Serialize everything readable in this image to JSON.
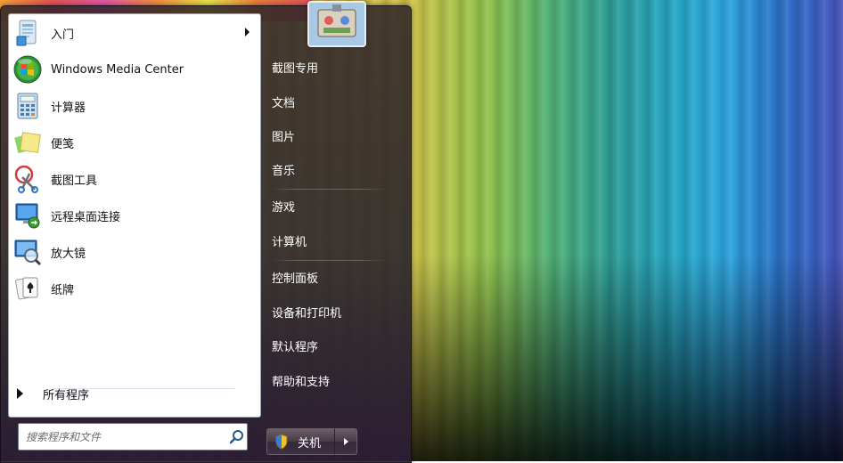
{
  "start_menu": {
    "programs": [
      {
        "label": "入门",
        "icon": "getting-started-icon",
        "has_submenu": true
      },
      {
        "label": "Windows Media Center",
        "icon": "windows-media-center-icon"
      },
      {
        "label": "计算器",
        "icon": "calculator-icon"
      },
      {
        "label": "便笺",
        "icon": "sticky-notes-icon"
      },
      {
        "label": "截图工具",
        "icon": "snipping-tool-icon"
      },
      {
        "label": "远程桌面连接",
        "icon": "remote-desktop-icon"
      },
      {
        "label": "放大镜",
        "icon": "magnifier-icon"
      },
      {
        "label": "纸牌",
        "icon": "solitaire-icon"
      }
    ],
    "all_programs_label": "所有程序",
    "search_placeholder": "搜索程序和文件",
    "right_items": [
      "截图专用",
      "文档",
      "图片",
      "音乐",
      "游戏",
      "计算机",
      "控制面板",
      "设备和打印机",
      "默认程序",
      "帮助和支持"
    ],
    "shutdown_label": "关机"
  }
}
